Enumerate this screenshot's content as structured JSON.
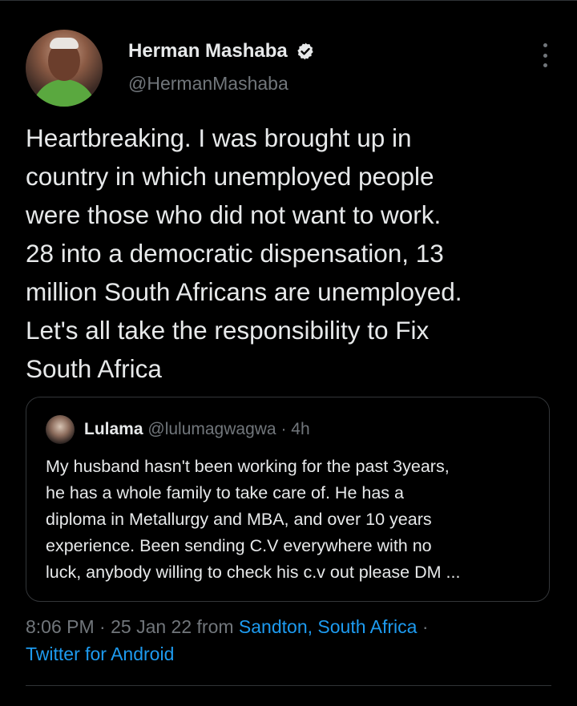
{
  "colors": {
    "background": "#000000",
    "text": "#e7e9ea",
    "muted": "#71767b",
    "link": "#1d9bf0",
    "verified": "#e7e9ea"
  },
  "author": {
    "name": "Herman Mashaba",
    "handle": "@HermanMashaba",
    "verified_icon": "verified-badge-icon",
    "more_icon": "more-vertical-icon"
  },
  "tweet": {
    "text": "Heartbreaking. I was brought up in\ncountry in which unemployed people\nwere those who did not want to work.\n28 into a democratic dispensation, 13\nmillion South Africans are unemployed.\nLet's all take the responsibility to Fix\nSouth Africa"
  },
  "quote": {
    "name": "Lulama",
    "handle": "@lulumagwagwa",
    "separator": "·",
    "time": "4h",
    "text": "My husband hasn't been working for the past 3years,\nhe has a whole family to take care of. He has a\ndiploma in Metallurgy and MBA, and over 10 years\nexperience. Been sending C.V everywhere with no\nluck, anybody willing to check his c.v out please DM ..."
  },
  "meta": {
    "time": "8:06 PM",
    "sep1": "·",
    "date": "25 Jan 22",
    "from": "from",
    "location": "Sandton, South Africa",
    "sep2": "·",
    "client": "Twitter for Android"
  }
}
